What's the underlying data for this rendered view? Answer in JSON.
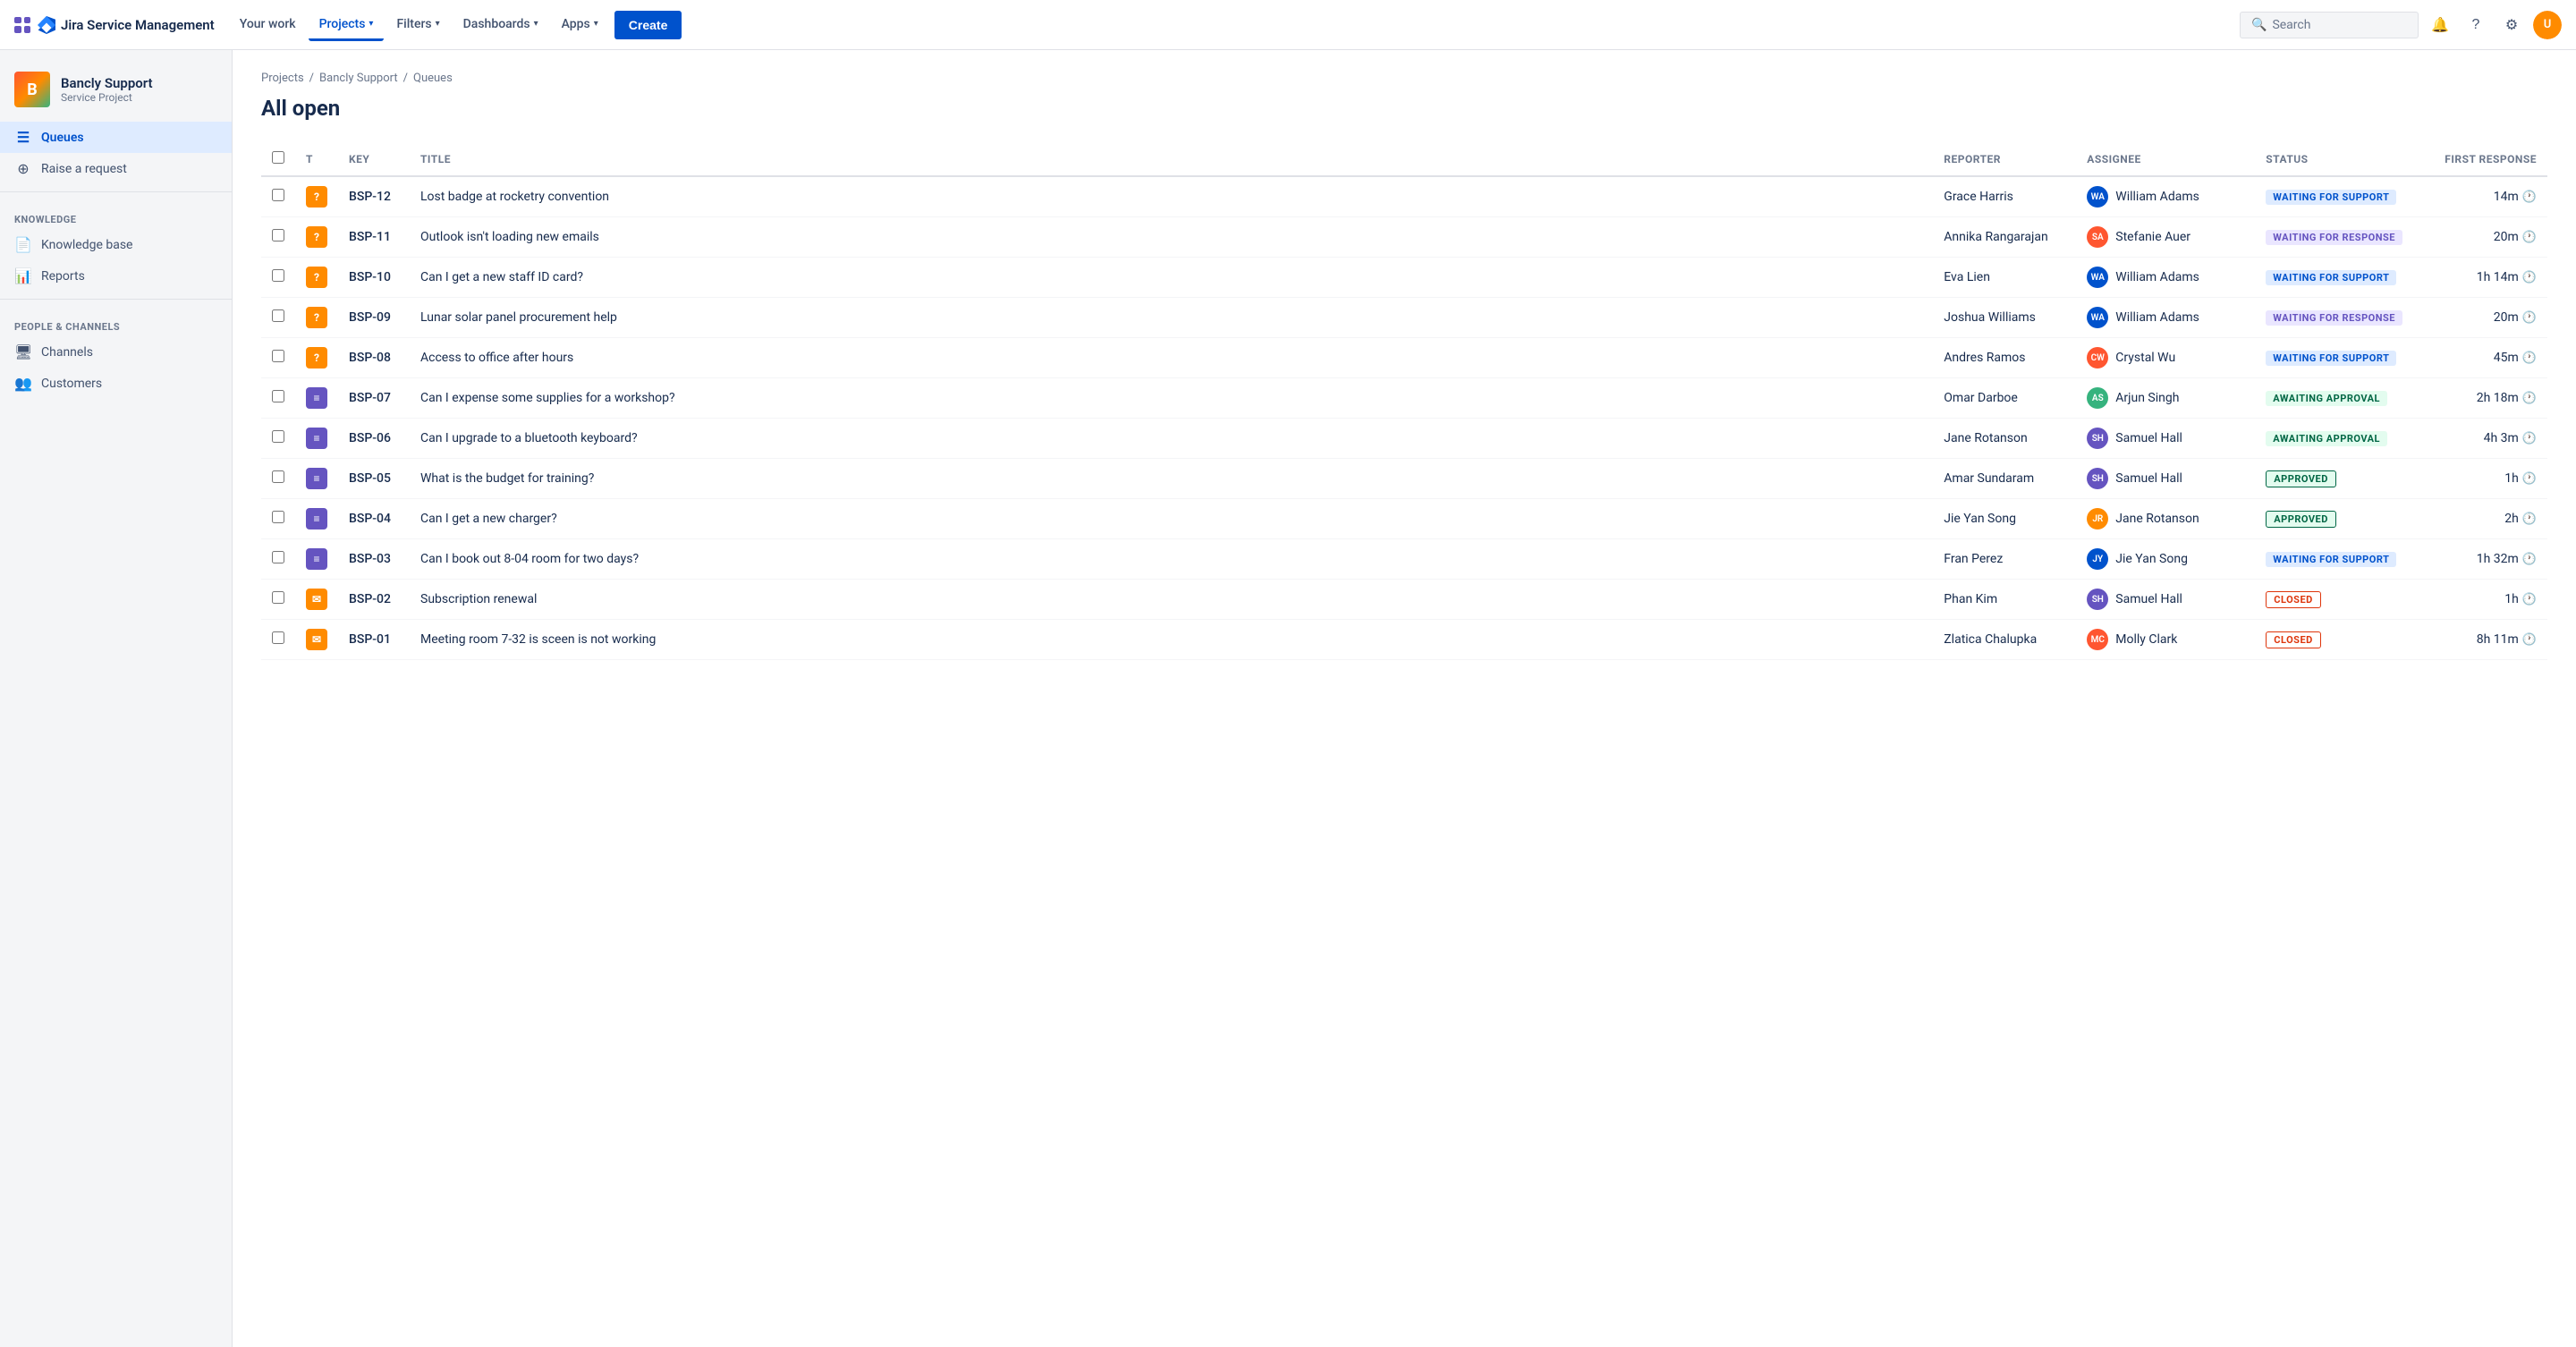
{
  "topnav": {
    "logo_text": "Jira Service Management",
    "nav_items": [
      {
        "label": "Your work",
        "active": false
      },
      {
        "label": "Projects",
        "active": true,
        "has_arrow": true
      },
      {
        "label": "Filters",
        "active": false,
        "has_arrow": true
      },
      {
        "label": "Dashboards",
        "active": false,
        "has_arrow": true
      },
      {
        "label": "Apps",
        "active": false,
        "has_arrow": true
      }
    ],
    "create_label": "Create",
    "search_placeholder": "Search"
  },
  "sidebar": {
    "project_name": "Bancly Support",
    "project_type": "Service Project",
    "project_initials": "B",
    "items_main": [
      {
        "id": "queues",
        "label": "Queues",
        "icon": "☰",
        "active": true
      },
      {
        "id": "raise",
        "label": "Raise a request",
        "icon": "⊕",
        "active": false
      }
    ],
    "knowledge_section": "KNOWLEDGE",
    "items_knowledge": [
      {
        "id": "knowledge-base",
        "label": "Knowledge base",
        "icon": "📄",
        "active": false
      },
      {
        "id": "reports",
        "label": "Reports",
        "icon": "📊",
        "active": false
      }
    ],
    "people_section": "PEOPLE & CHANNELS",
    "items_people": [
      {
        "id": "channels",
        "label": "Channels",
        "icon": "🖥",
        "active": false
      },
      {
        "id": "customers",
        "label": "Customers",
        "icon": "👥",
        "active": false
      }
    ]
  },
  "breadcrumb": {
    "items": [
      "Projects",
      "Bancly Support",
      "Queues"
    ]
  },
  "page_title": "All open",
  "table": {
    "columns": [
      "",
      "T",
      "Key",
      "Title",
      "Reporter",
      "Assignee",
      "Status",
      "First response"
    ],
    "rows": [
      {
        "key": "BSP-12",
        "type": "question",
        "title": "Lost badge at rocketry convention",
        "reporter": "Grace Harris",
        "assignee": "William Adams",
        "assignee_color": "#0052CC",
        "assignee_initials": "WA",
        "status": "WAITING FOR SUPPORT",
        "status_class": "status-waiting-support",
        "response": "14m"
      },
      {
        "key": "BSP-11",
        "type": "question",
        "title": "Outlook isn't loading new emails",
        "reporter": "Annika Rangarajan",
        "assignee": "Stefanie Auer",
        "assignee_color": "#FF5630",
        "assignee_initials": "SA",
        "status": "WAITING FOR RESPONSE",
        "status_class": "status-waiting-response",
        "response": "20m"
      },
      {
        "key": "BSP-10",
        "type": "question",
        "title": "Can I get a new staff ID card?",
        "reporter": "Eva Lien",
        "assignee": "William Adams",
        "assignee_color": "#0052CC",
        "assignee_initials": "WA",
        "status": "WAITING FOR SUPPORT",
        "status_class": "status-waiting-support",
        "response": "1h 14m"
      },
      {
        "key": "BSP-09",
        "type": "question",
        "title": "Lunar solar panel procurement help",
        "reporter": "Joshua Williams",
        "assignee": "William Adams",
        "assignee_color": "#0052CC",
        "assignee_initials": "WA",
        "status": "WAITING FOR RESPONSE",
        "status_class": "status-waiting-response",
        "response": "20m"
      },
      {
        "key": "BSP-08",
        "type": "question",
        "title": "Access to office after hours",
        "reporter": "Andres Ramos",
        "assignee": "Crystal Wu",
        "assignee_color": "#FF5630",
        "assignee_initials": "CW",
        "status": "WAITING FOR SUPPORT",
        "status_class": "status-waiting-support",
        "response": "45m"
      },
      {
        "key": "BSP-07",
        "type": "task",
        "title": "Can I expense some supplies for a workshop?",
        "reporter": "Omar Darboe",
        "assignee": "Arjun Singh",
        "assignee_color": "#36B37E",
        "assignee_initials": "AS",
        "status": "AWAITING APPROVAL",
        "status_class": "status-awaiting-approval",
        "response": "2h 18m"
      },
      {
        "key": "BSP-06",
        "type": "task",
        "title": "Can I upgrade to a bluetooth keyboard?",
        "reporter": "Jane Rotanson",
        "assignee": "Samuel Hall",
        "assignee_color": "#6554C0",
        "assignee_initials": "SH",
        "status": "AWAITING APPROVAL",
        "status_class": "status-awaiting-approval",
        "response": "4h 3m"
      },
      {
        "key": "BSP-05",
        "type": "task",
        "title": "What is the budget for training?",
        "reporter": "Amar Sundaram",
        "assignee": "Samuel Hall",
        "assignee_color": "#6554C0",
        "assignee_initials": "SH",
        "status": "APPROVED",
        "status_class": "status-approved",
        "response": "1h"
      },
      {
        "key": "BSP-04",
        "type": "task",
        "title": "Can I get a new charger?",
        "reporter": "Jie Yan Song",
        "assignee": "Jane Rotanson",
        "assignee_color": "#FF8B00",
        "assignee_initials": "JR",
        "status": "APPROVED",
        "status_class": "status-approved",
        "response": "2h"
      },
      {
        "key": "BSP-03",
        "type": "task",
        "title": "Can I book out 8-04 room for two days?",
        "reporter": "Fran Perez",
        "assignee": "Jie Yan Song",
        "assignee_color": "#0052CC",
        "assignee_initials": "JY",
        "status": "WAITING FOR SUPPORT",
        "status_class": "status-waiting-support",
        "response": "1h 32m"
      },
      {
        "key": "BSP-02",
        "type": "email",
        "title": "Subscription renewal",
        "reporter": "Phan Kim",
        "assignee": "Samuel Hall",
        "assignee_color": "#6554C0",
        "assignee_initials": "SH",
        "status": "CLOSED",
        "status_class": "status-closed",
        "response": "1h"
      },
      {
        "key": "BSP-01",
        "type": "email",
        "title": "Meeting room 7-32 is sceen is not working",
        "reporter": "Zlatica Chalupka",
        "assignee": "Molly Clark",
        "assignee_color": "#FF5630",
        "assignee_initials": "MC",
        "status": "CLOSED",
        "status_class": "status-closed",
        "response": "8h 11m"
      }
    ]
  }
}
